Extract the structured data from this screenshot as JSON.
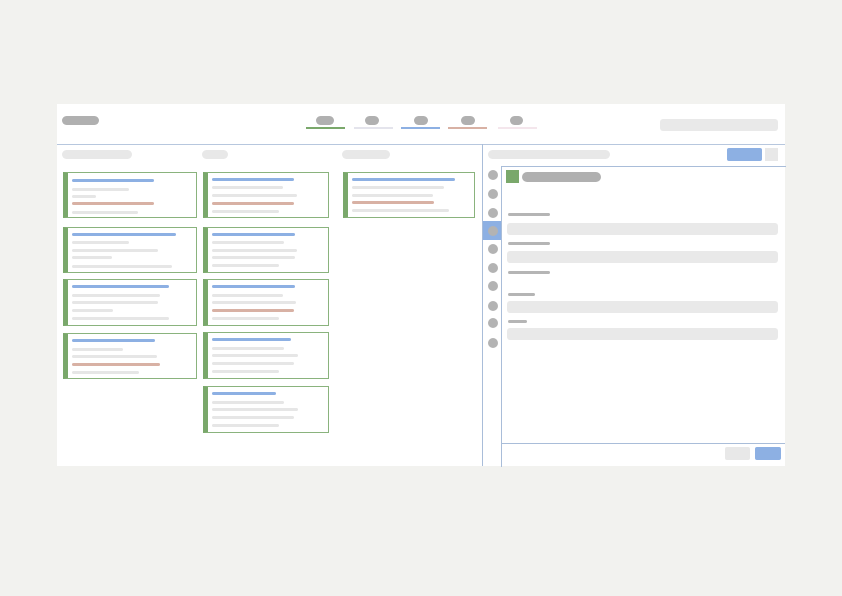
{
  "colors": {
    "background": "#f2f2ef",
    "accent_blue": "#8db0e3",
    "accent_green": "#7aa86b",
    "accent_rose": "#d8b1a4",
    "placeholder_grey": "#b0b0b0",
    "placeholder_light": "#e8e8e8"
  },
  "topbar": {
    "logo_icon": "logo-placeholder",
    "tabs": [
      {
        "underline_color": "#7aa86b"
      },
      {
        "underline_color": "#e4e4ec"
      },
      {
        "underline_color": "#8db0e3"
      },
      {
        "underline_color": "#d8b1a4"
      },
      {
        "underline_color": "#f4e6ec"
      }
    ],
    "search_placeholder": ""
  },
  "board": {
    "columns": [
      {
        "card_count": 4
      },
      {
        "card_count": 5
      },
      {
        "card_count": 1
      }
    ]
  },
  "detail_panel": {
    "header_icon": "green-square-icon",
    "primary_button_color": "#8db0e3",
    "rail_icons": 10,
    "active_rail_index": 3,
    "fields": 5
  }
}
